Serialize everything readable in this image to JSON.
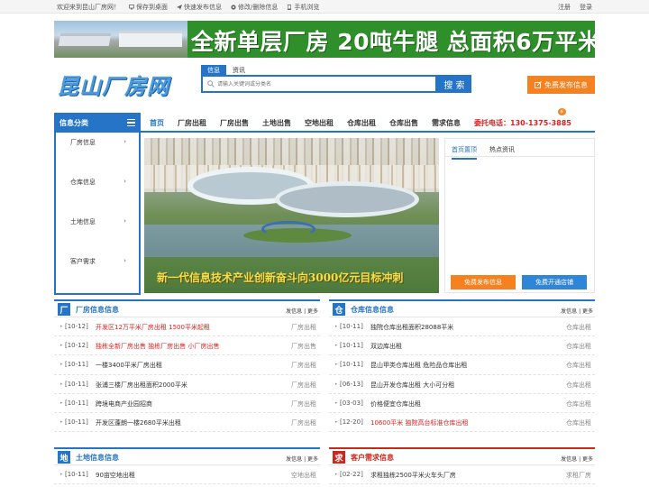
{
  "topbar": {
    "welcome": "欢迎来到昆山厂房网！",
    "links": [
      {
        "label": "保存到桌面",
        "icon": "monitor-icon"
      },
      {
        "label": "快速发布信息",
        "icon": "send-icon"
      },
      {
        "label": "修改/删除信息",
        "icon": "gear-icon"
      },
      {
        "label": "手机浏览",
        "icon": "phone-icon"
      }
    ],
    "register": "注册",
    "login": "登录"
  },
  "banner": {
    "text": "全新单层厂房 20吨牛腿 总面积6万平米"
  },
  "logo": {
    "text": "昆山厂房网"
  },
  "search": {
    "tabs": [
      "信息",
      "资讯"
    ],
    "active_tab": 0,
    "placeholder": "请输入关键词或分类名",
    "button": "搜 索"
  },
  "publish_button": "免费发布信息",
  "nav": {
    "category_label": "信息分类",
    "links": [
      "首页",
      "厂房出租",
      "厂房出售",
      "土地出售",
      "空地出租",
      "仓库出租",
      "仓库出售",
      "需求信息"
    ],
    "phone": "委托电话：130-1375-3885",
    "badge": "新"
  },
  "categories": [
    "厂房信息",
    "仓库信息",
    "土地信息",
    "客户需求"
  ],
  "hero": {
    "caption": "新一代信息技术产业创新奋斗向3000亿元目标冲刺"
  },
  "right_panel": {
    "tabs": [
      "首页置顶",
      "热点资讯"
    ],
    "btn_publish": "免费发布信息",
    "btn_shop": "免费开通店铺",
    "colors": {
      "publish": "#f58220",
      "shop": "#2f86d6"
    }
  },
  "sections": {
    "factory": {
      "icon_char": "厂",
      "title": "厂房信息信息",
      "more": "发信息 | 更多",
      "rows": [
        {
          "date": "[10-12]",
          "title": "开发区12万平米厂房出租 1500平米起租",
          "cat": "厂房出租",
          "hot": true
        },
        {
          "date": "[10-12]",
          "title": "独栋全新厂房出售 独栋厂房出售 小厂房出售",
          "cat": "厂房出售",
          "hot": true
        },
        {
          "date": "[10-11]",
          "title": "一楼3400平米厂房出租",
          "cat": "厂房出租",
          "hot": false
        },
        {
          "date": "[10-11]",
          "title": "张浦三楼厂房出租面积2000平米",
          "cat": "厂房出租",
          "hot": false
        },
        {
          "date": "[10-11]",
          "title": "跨境电商产业园招商",
          "cat": "厂房出租",
          "hot": false
        },
        {
          "date": "[10-11]",
          "title": "开发区蓬朗一楼2680平米出租",
          "cat": "厂房出租",
          "hot": false
        }
      ]
    },
    "warehouse": {
      "icon_char": "仓",
      "title": "仓库信息信息",
      "more": "发信息 | 更多",
      "rows": [
        {
          "date": "[10-11]",
          "title": "独院仓库出租面积28088平米",
          "cat": "仓库出租",
          "hot": false
        },
        {
          "date": "[10-11]",
          "title": "双边库出租",
          "cat": "仓库出租",
          "hot": false
        },
        {
          "date": "[10-11]",
          "title": "昆山甲类仓库出租 危险品仓库出租",
          "cat": "仓库出租",
          "hot": false
        },
        {
          "date": "[06-13]",
          "title": "昆山开发仓库出租 大小可分租",
          "cat": "仓库出租",
          "hot": false
        },
        {
          "date": "[03-03]",
          "title": "价格便宜仓库出租",
          "cat": "仓库出租",
          "hot": false
        },
        {
          "date": "[12-20]",
          "title": "10600平米 独院高台标准仓库出租",
          "cat": "仓库出租",
          "hot": true
        }
      ]
    },
    "land": {
      "icon_char": "地",
      "title": "土地信息信息",
      "more": "发信息 | 更多",
      "rows": [
        {
          "date": "[10-11]",
          "title": "90亩空地出租",
          "cat": "空地出租",
          "hot": false
        }
      ]
    },
    "demand": {
      "icon_char": "求",
      "title": "客户需求信息",
      "more": "发信息 | 更多",
      "rows": [
        {
          "date": "[02-22]",
          "title": "求租独栋2500平米火车头厂房",
          "cat": "求租厂房",
          "hot": false
        }
      ]
    }
  }
}
